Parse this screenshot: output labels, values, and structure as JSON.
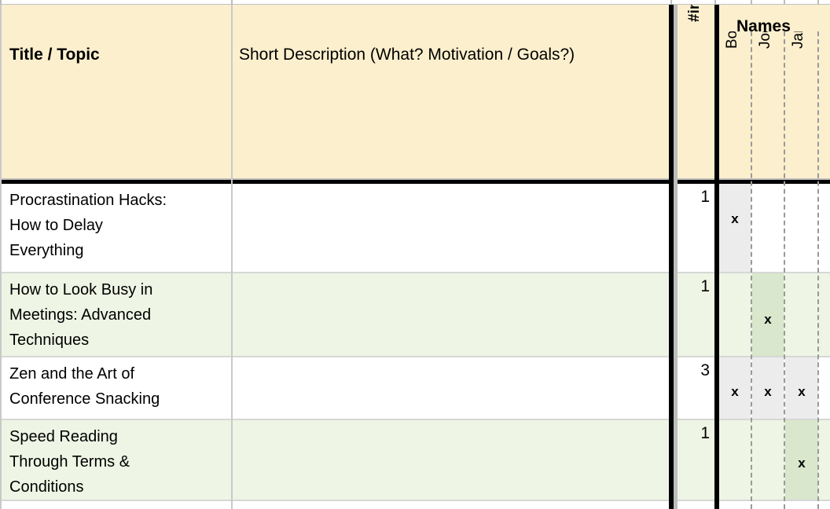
{
  "sheet": {
    "header": {
      "title_column": "Title / Topic",
      "description_column": "Short Description (What? Motivation / Goals?)",
      "interested_column": "#interested",
      "names_group": "Names",
      "names": [
        "Bob",
        "Joe",
        "Jane"
      ]
    },
    "colors": {
      "header_background": "#fcefcd",
      "row_white": "#ffffff",
      "row_green": "#eef5e4",
      "mark_on_white": "#ececec",
      "mark_on_green": "#d9e7cd",
      "rule_gray": "#bdbdbd",
      "rule_black": "#000000",
      "text": "#000000"
    },
    "mark_symbol": "x",
    "rows": [
      {
        "title": "Procrastination Hacks: How to Delay Everything",
        "title_lines": [
          "Procrastination Hacks:",
          "How to Delay",
          "Everything"
        ],
        "description": "",
        "interested": "1",
        "marks": [
          "x",
          "",
          ""
        ]
      },
      {
        "title": "How to Look Busy in Meetings: Advanced Techniques",
        "title_lines": [
          "How to Look Busy in",
          "Meetings: Advanced",
          "Techniques"
        ],
        "description": "",
        "interested": "1",
        "marks": [
          "",
          "x",
          ""
        ]
      },
      {
        "title": "Zen and the Art of Conference Snacking",
        "title_lines": [
          "Zen and the Art of",
          "Conference Snacking"
        ],
        "description": "",
        "interested": "3",
        "marks": [
          "x",
          "x",
          "x"
        ]
      },
      {
        "title": "Speed Reading Through Terms & Conditions",
        "title_lines": [
          "Speed Reading",
          "Through Terms &",
          "Conditions"
        ],
        "description": "",
        "interested": "1",
        "marks": [
          "",
          "",
          "x"
        ]
      },
      {
        "title": "",
        "title_lines": [],
        "description": "",
        "interested": "",
        "marks": [
          "",
          "",
          ""
        ]
      }
    ]
  }
}
